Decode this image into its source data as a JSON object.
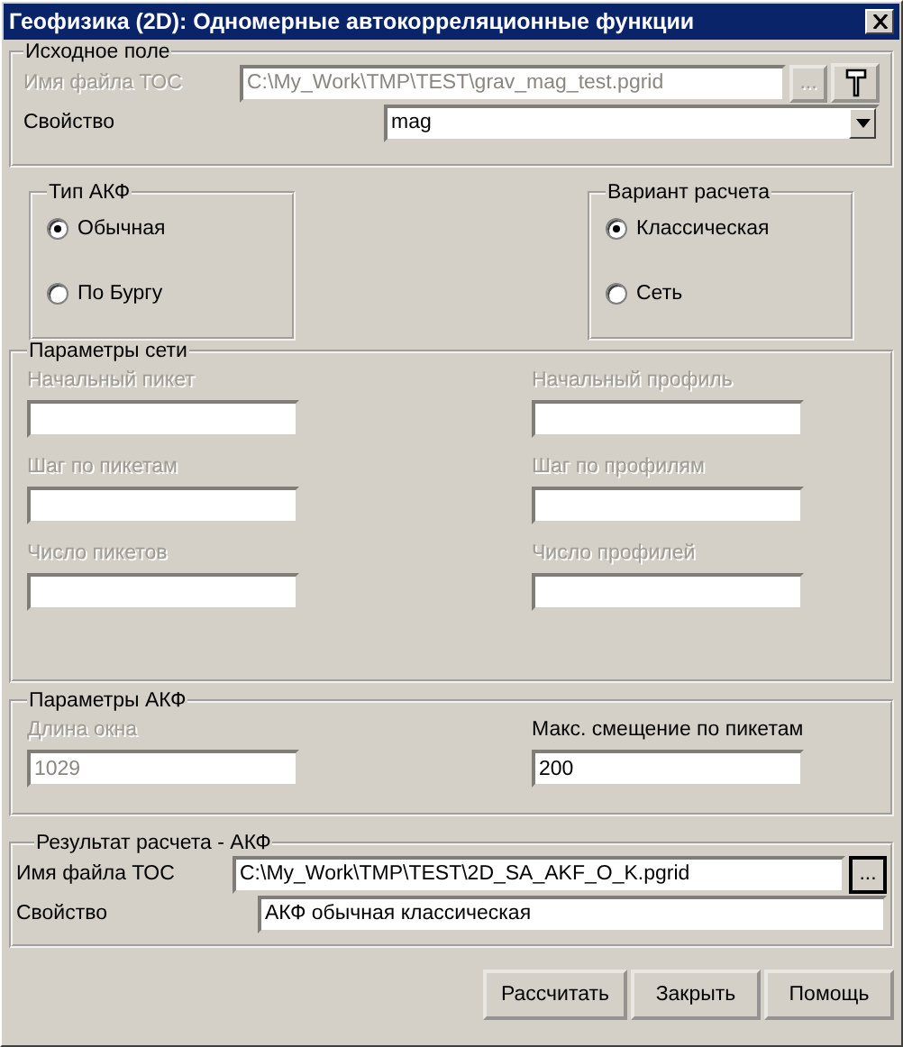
{
  "window": {
    "title": "Геофизика (2D): Одномерные автокорреляционные функции"
  },
  "source": {
    "title": "Исходное поле",
    "file": {
      "label": "Имя файла ТОС",
      "value": "C:\\My_Work\\TMP\\TEST\\grav_mag_test.pgrid",
      "disabled": true,
      "browse": "...",
      "browse_disabled": true
    },
    "property": {
      "label": "Свойство",
      "value": "mag"
    }
  },
  "akf_type": {
    "title": "Тип АКФ",
    "options": [
      {
        "label": "Обычная",
        "selected": true
      },
      {
        "label": "По Бургу",
        "selected": false
      }
    ]
  },
  "calc_variant": {
    "title": "Вариант расчета",
    "options": [
      {
        "label": "Классическая",
        "selected": true
      },
      {
        "label": "Сеть",
        "selected": false
      }
    ]
  },
  "grid_params": {
    "title": "Параметры сети",
    "fields": [
      {
        "label": "Начальный пикет",
        "disabled": true
      },
      {
        "label": "Начальный профиль",
        "disabled": true
      },
      {
        "label": "Шаг по пикетам",
        "disabled": true
      },
      {
        "label": "Шаг по профилям",
        "disabled": true
      },
      {
        "label": "Число пикетов",
        "disabled": true
      },
      {
        "label": "Число профилей",
        "disabled": true
      }
    ]
  },
  "akf_params": {
    "title": "Параметры АКФ",
    "fields": [
      {
        "label": "Длина окна",
        "value": "1029",
        "disabled": true
      },
      {
        "label": "Макс. смещение по пикетам",
        "value": "200",
        "disabled": false
      }
    ]
  },
  "result": {
    "title": "Результат расчета - АКФ",
    "file": {
      "label": "Имя файла ТОС",
      "value": "C:\\My_Work\\TMP\\TEST\\2D_SA_AKF_O_K.pgrid",
      "browse": "..."
    },
    "property": {
      "label": "Свойство",
      "value": "АКФ обычная классическая"
    }
  },
  "buttons": [
    "Рассчитать",
    "Закрыть",
    "Помощь"
  ]
}
